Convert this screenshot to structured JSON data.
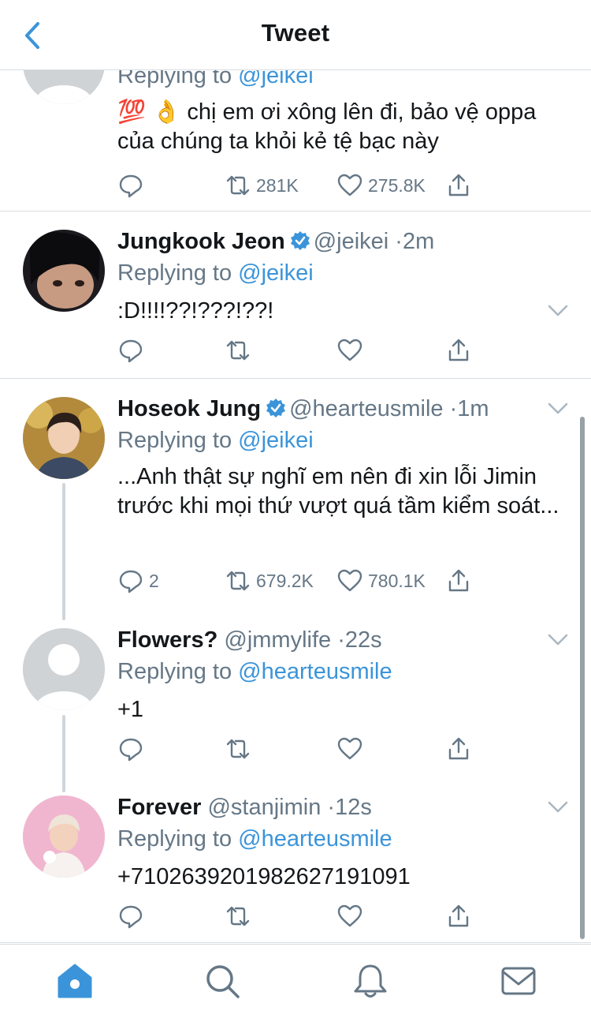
{
  "header": {
    "title": "Tweet",
    "back_icon": "chevron-left-icon"
  },
  "colors": {
    "accent": "#3b94d9",
    "muted": "#657786",
    "text": "#14171a",
    "separator": "#d8dde1",
    "like_red": "#e0245e"
  },
  "tweets": [
    {
      "name": "",
      "handle": "",
      "time": "",
      "replying_prefix": "Replying to",
      "replying_to": "@jeikei",
      "text": "💯 👌 chị em ơi xông lên đi, bảo vệ oppa của chúng ta khỏi kẻ tệ bạc này",
      "replies": "",
      "retweets": "281K",
      "likes": "275.8K"
    },
    {
      "name": "Jungkook Jeon",
      "handle": "@jeikei",
      "dot": "·",
      "time": "2m",
      "replying_prefix": "Replying to",
      "replying_to": "@jeikei",
      "text": ":D!!!!??!???!??!",
      "replies": "",
      "retweets": "",
      "likes": ""
    },
    {
      "name": "Hoseok Jung",
      "handle": "@hearteusmile",
      "dot": "·",
      "time": "1m",
      "replying_prefix": "Replying to",
      "replying_to": "@jeikei",
      "text": "...Anh thật sự nghĩ em nên đi xin lỗi Jimin trước khi mọi thứ vượt quá tầm kiểm soát...",
      "replies": "2",
      "retweets": "679.2K",
      "likes": "780.1K"
    },
    {
      "name": "Flowers?",
      "handle": "@jmmylife",
      "dot": "·",
      "time": "22s",
      "replying_prefix": "Replying to",
      "replying_to": "@hearteusmile",
      "text": "+1",
      "replies": "",
      "retweets": "",
      "likes": ""
    },
    {
      "name": "Forever",
      "handle": "@stanjimin",
      "dot": "·",
      "time": "12s",
      "replying_prefix": "Replying to",
      "replying_to": "@hearteusmile",
      "text": "+7102639201982627191091",
      "replies": "",
      "retweets": "",
      "likes": ""
    }
  ],
  "tabbar": {
    "items": [
      {
        "icon": "home-icon",
        "active": true
      },
      {
        "icon": "search-icon",
        "active": false
      },
      {
        "icon": "notifications-bell-icon",
        "active": false
      },
      {
        "icon": "messages-envelope-icon",
        "active": false
      }
    ]
  }
}
